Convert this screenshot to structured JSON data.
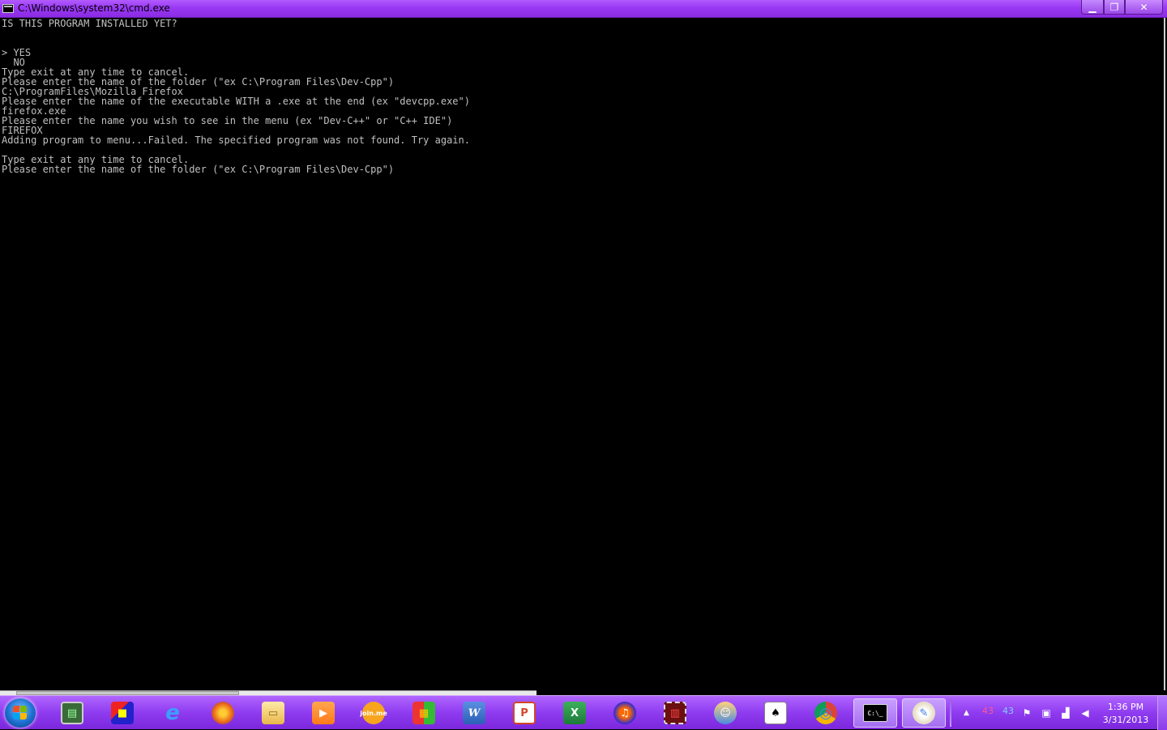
{
  "window": {
    "title": "C:\\Windows\\system32\\cmd.exe",
    "icon": "cmd-icon",
    "buttons": {
      "minimize": "▁",
      "maximize": "❐",
      "close": "✕"
    }
  },
  "console": {
    "lines": [
      "IS THIS PROGRAM INSTALLED YET?",
      "",
      "",
      "> YES",
      "  NO",
      "Type exit at any time to cancel.",
      "Please enter the name of the folder (\"ex C:\\Program Files\\Dev-Cpp\")",
      "C:\\ProgramFiles\\Mozilla Firefox",
      "Please enter the name of the executable WITH a .exe at the end (ex \"devcpp.exe\")",
      "firefox.exe",
      "Please enter the name you wish to see in the menu (ex \"Dev-C++\" or \"C++ IDE\")",
      "FIREFOX",
      "Adding program to menu...Failed. The specified program was not found. Try again.",
      "",
      "Type exit at any time to cancel.",
      "Please enter the name of the folder (\"ex C:\\Program Files\\Dev-Cpp\")"
    ],
    "text_color": "#c0c0c0",
    "background": "#000000"
  },
  "taskbar": {
    "accent": "#8f3cf0",
    "items": [
      {
        "icon": "system-monitor-icon",
        "glyph": "▤"
      },
      {
        "icon": "blocks-app-icon",
        "glyph": "■"
      },
      {
        "icon": "internet-explorer-icon",
        "glyph": "e"
      },
      {
        "icon": "firefox-icon",
        "glyph": "◉"
      },
      {
        "icon": "file-explorer-icon",
        "glyph": "▭"
      },
      {
        "icon": "media-player-icon",
        "glyph": "▶"
      },
      {
        "icon": "joinme-icon",
        "glyph": "join.me"
      },
      {
        "icon": "color-blocks-icon",
        "glyph": "▦"
      },
      {
        "icon": "word-icon",
        "glyph": "W"
      },
      {
        "icon": "powerpoint-icon",
        "glyph": "P"
      },
      {
        "icon": "excel-icon",
        "glyph": "X"
      },
      {
        "icon": "audio-app-icon",
        "glyph": "♫"
      },
      {
        "icon": "film-icon",
        "glyph": "▥"
      },
      {
        "icon": "user-app-icon",
        "glyph": "☺"
      },
      {
        "icon": "solitaire-icon",
        "glyph": "♠"
      },
      {
        "icon": "chrome-icon",
        "glyph": "◎"
      },
      {
        "icon": "cmd-icon",
        "glyph": "C:\\_"
      },
      {
        "icon": "paint-icon",
        "glyph": "✎"
      }
    ],
    "tray": {
      "expand_icon": "▲",
      "value1": "43",
      "value2": "43",
      "icons": [
        "flag-icon",
        "network-icon",
        "signal-icon",
        "volume-icon"
      ]
    },
    "clock": {
      "time": "1:36 PM",
      "date": "3/31/2013"
    }
  }
}
